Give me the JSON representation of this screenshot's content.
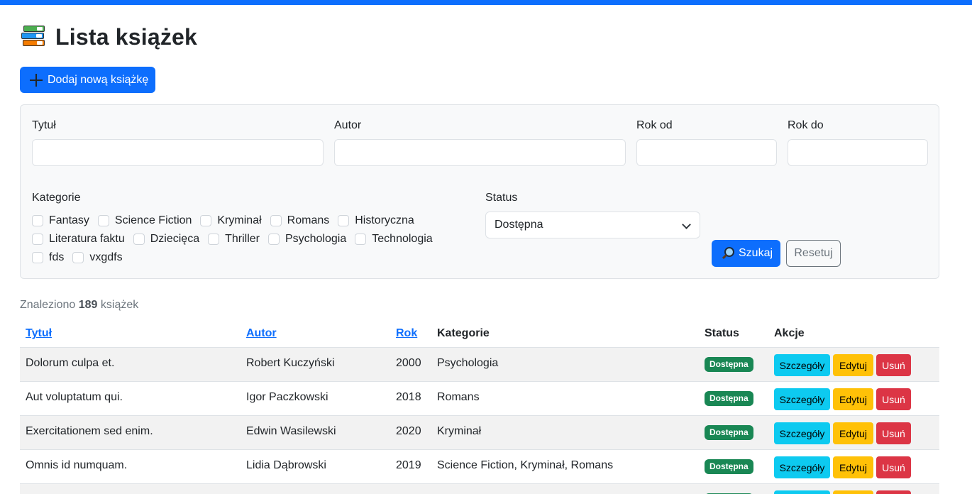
{
  "page": {
    "title": "Lista książek",
    "add_button": "Dodaj nową książkę",
    "accent_color": "#0d6efd"
  },
  "filters": {
    "title_label": "Tytuł",
    "title_value": "",
    "author_label": "Autor",
    "author_value": "",
    "year_from_label": "Rok od",
    "year_from_value": "",
    "year_to_label": "Rok do",
    "year_to_value": "",
    "categories_label": "Kategorie",
    "categories": [
      {
        "label": "Fantasy",
        "checked": false
      },
      {
        "label": "Science Fiction",
        "checked": false
      },
      {
        "label": "Kryminał",
        "checked": false
      },
      {
        "label": "Romans",
        "checked": false
      },
      {
        "label": "Historyczna",
        "checked": false
      },
      {
        "label": "Literatura faktu",
        "checked": false
      },
      {
        "label": "Dziecięca",
        "checked": false
      },
      {
        "label": "Thriller",
        "checked": false
      },
      {
        "label": "Psychologia",
        "checked": false
      },
      {
        "label": "Technologia",
        "checked": false
      },
      {
        "label": "fds",
        "checked": false
      },
      {
        "label": "vxgdfs",
        "checked": false
      }
    ],
    "status_label": "Status",
    "status_value": "Dostępna",
    "search_button": "Szukaj",
    "reset_button": "Resetuj"
  },
  "results": {
    "prefix": "Znaleziono",
    "count": "189",
    "suffix": "książek"
  },
  "table": {
    "headers": {
      "title": "Tytuł",
      "author": "Autor",
      "year": "Rok",
      "categories": "Kategorie",
      "status": "Status",
      "actions": "Akcje"
    },
    "action_labels": {
      "details": "Szczegóły",
      "edit": "Edytuj",
      "delete": "Usuń"
    },
    "rows": [
      {
        "title": "Dolorum culpa et.",
        "author": "Robert Kuczyński",
        "year": "2000",
        "categories": "Psychologia",
        "status": "Dostępna"
      },
      {
        "title": "Aut voluptatum qui.",
        "author": "Igor Paczkowski",
        "year": "2018",
        "categories": "Romans",
        "status": "Dostępna"
      },
      {
        "title": "Exercitationem sed enim.",
        "author": "Edwin Wasilewski",
        "year": "2020",
        "categories": "Kryminał",
        "status": "Dostępna"
      },
      {
        "title": "Omnis id numquam.",
        "author": "Lidia Dąbrowski",
        "year": "2019",
        "categories": "Science Fiction, Kryminał, Romans",
        "status": "Dostępna"
      }
    ]
  }
}
